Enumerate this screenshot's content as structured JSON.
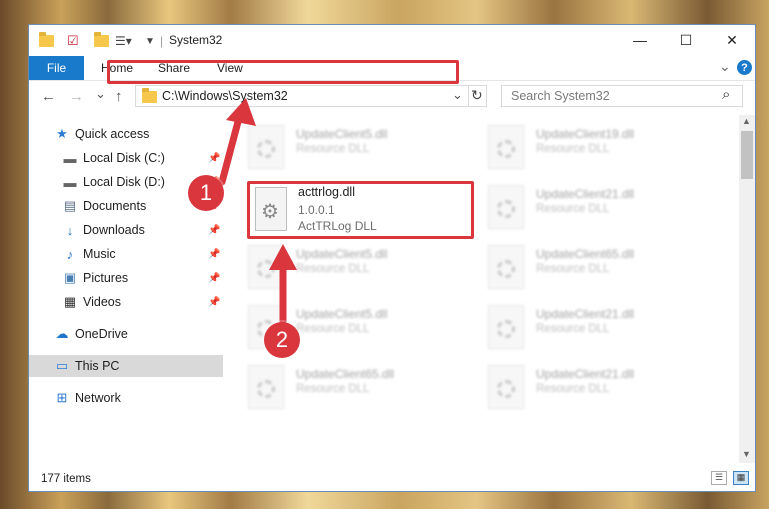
{
  "window": {
    "title": "System32",
    "minimize": "—",
    "maximize": "☐",
    "close": "✕"
  },
  "ribbon": {
    "file": "File",
    "tabs": [
      "Home",
      "Share",
      "View"
    ],
    "expand": "⌄",
    "help": "?"
  },
  "nav": {
    "back": "←",
    "forward": "→",
    "recent": "⌄",
    "up": "↑",
    "address": "C:\\Windows\\System32",
    "dropdown": "⌄",
    "refresh": "↻",
    "search_placeholder": "Search System32",
    "search_icon": "⌕"
  },
  "sidebar": {
    "items": [
      {
        "label": "Quick access",
        "icon": "star-icon",
        "glyph": "★",
        "pinned": false
      },
      {
        "label": "Local Disk (C:)",
        "icon": "drive-icon",
        "glyph": "▬",
        "pinned": true
      },
      {
        "label": "Local Disk (D:)",
        "icon": "drive-icon",
        "glyph": "▬",
        "pinned": true
      },
      {
        "label": "Documents",
        "icon": "documents-icon",
        "glyph": "▤",
        "pinned": true
      },
      {
        "label": "Downloads",
        "icon": "download-icon",
        "glyph": "↓",
        "pinned": true
      },
      {
        "label": "Music",
        "icon": "music-icon",
        "glyph": "♪",
        "pinned": true
      },
      {
        "label": "Pictures",
        "icon": "pictures-icon",
        "glyph": "▣",
        "pinned": true
      },
      {
        "label": "Videos",
        "icon": "videos-icon",
        "glyph": "▦",
        "pinned": true
      },
      {
        "label": "OneDrive",
        "icon": "cloud-icon",
        "glyph": "☁",
        "pinned": false
      },
      {
        "label": "This PC",
        "icon": "computer-icon",
        "glyph": "▭",
        "pinned": false
      },
      {
        "label": "Network",
        "icon": "network-icon",
        "glyph": "⊞",
        "pinned": false
      }
    ],
    "pin_glyph": "📌"
  },
  "files": {
    "blurred": [
      {
        "name": "UpdateClient5.dll",
        "type": "Resource DLL"
      },
      {
        "name": "UpdateClient19.dll",
        "type": "Resource DLL"
      },
      {
        "name": "UpdateClient21.dll",
        "type": "Resource DLL"
      },
      {
        "name": "UpdateClient5.dll",
        "type": "Resource DLL"
      },
      {
        "name": "UpdateClient65.dll",
        "type": "Resource DLL"
      },
      {
        "name": "UpdateClient5.dll",
        "type": "Resource DLL"
      },
      {
        "name": "UpdateClient21.dll",
        "type": "Resource DLL"
      },
      {
        "name": "UpdateClient65.dll",
        "type": "Resource DLL"
      },
      {
        "name": "UpdateClient21.dll",
        "type": "Resource DLL"
      }
    ],
    "focus": {
      "name": "acttrlog.dll",
      "version": "1.0.0.1",
      "description": "ActTRLog DLL"
    }
  },
  "status": {
    "count": "177 items"
  },
  "annotations": {
    "step1": "1",
    "step2": "2",
    "color": "#d9363e"
  }
}
